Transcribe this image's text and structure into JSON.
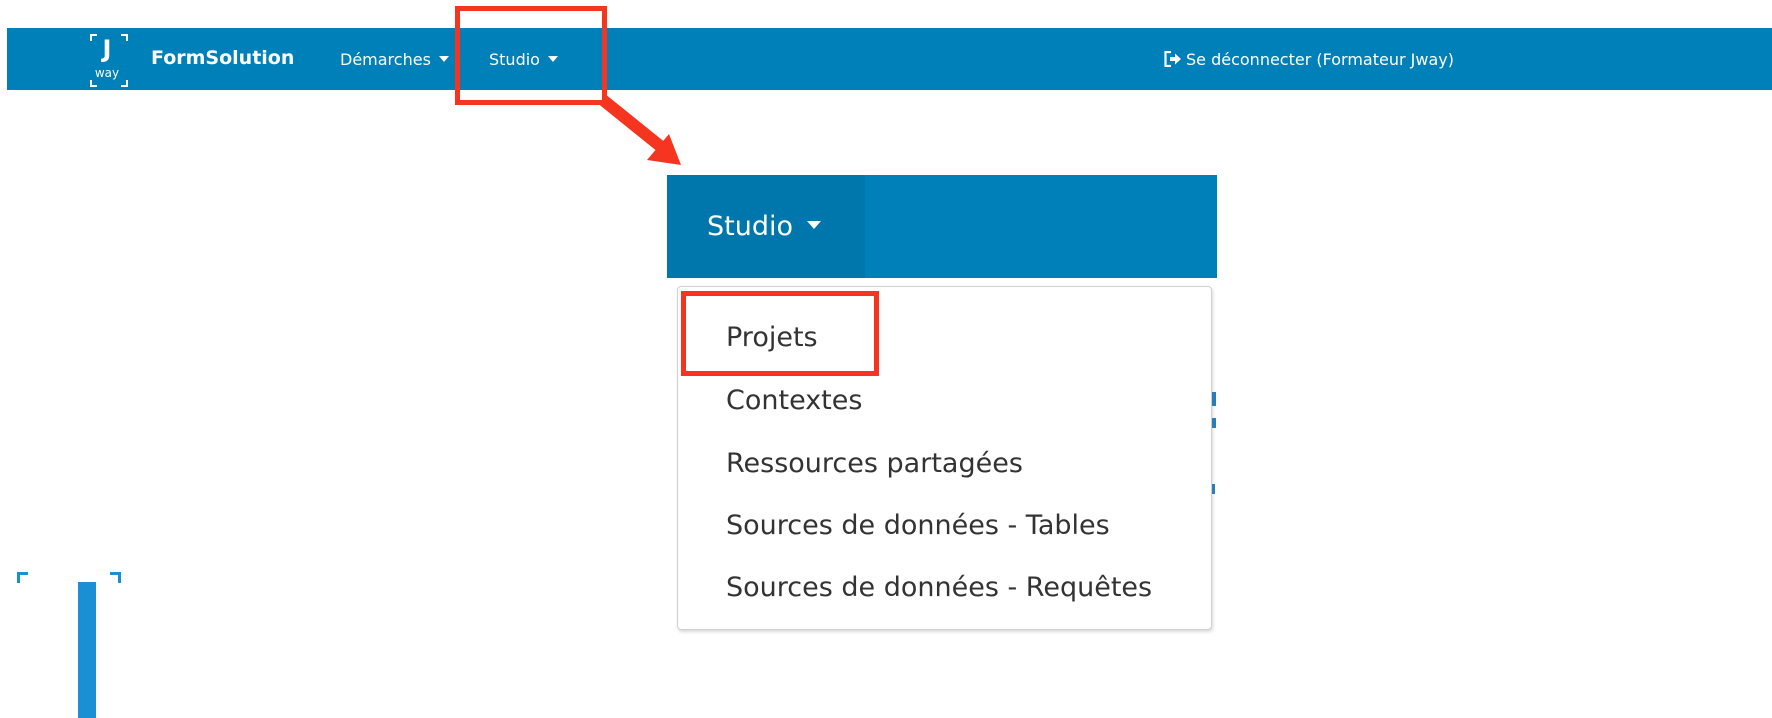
{
  "navbar": {
    "logo": {
      "letter": "J",
      "sub": "way"
    },
    "brand": "FormSolution",
    "menus": [
      {
        "label": "Démarches"
      },
      {
        "label": "Studio"
      }
    ],
    "logout_label": "Se déconnecter (Formateur Jway)"
  },
  "dropdown": {
    "toggle_label": "Studio",
    "items": [
      {
        "label": "Projets",
        "highlighted": true
      },
      {
        "label": "Contextes"
      },
      {
        "label": "Ressources partagées"
      },
      {
        "label": "Sources de données - Tables"
      },
      {
        "label": "Sources de données - Requêtes"
      }
    ]
  },
  "colors": {
    "navbar": "#0080b8",
    "highlight": "#f5351f",
    "logo_blue": "#1a8fd4"
  },
  "icons": {
    "logout": "sign-out-icon",
    "caret": "caret-down-icon"
  }
}
